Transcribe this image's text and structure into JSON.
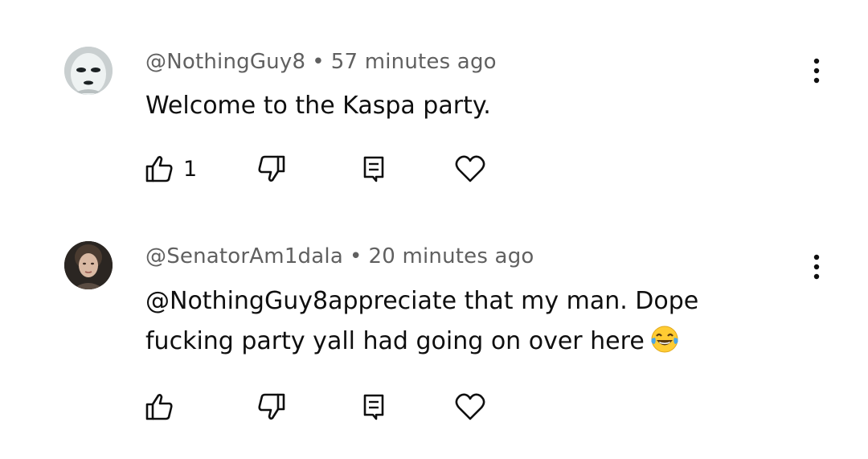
{
  "comments": [
    {
      "author": "@NothingGuy8",
      "separator": "•",
      "time": "57 minutes ago",
      "text": "Welcome to the Kaspa party.",
      "likes": "1",
      "avatar_icon": "white-mask-avatar",
      "menu_icon": "more-vert-icon"
    },
    {
      "author": "@SenatorAm1dala",
      "separator": "•",
      "time": "20 minutes ago",
      "text_line1": "@NothingGuy8appreciate that my man. Dope",
      "text_line2": "fucking party yall had going on over here",
      "emoji": "tears-of-joy-emoji",
      "likes": "",
      "avatar_icon": "portrait-avatar",
      "menu_icon": "more-vert-icon"
    }
  ],
  "action_icons": [
    "like-icon",
    "dislike-icon",
    "reply-icon",
    "heart-icon"
  ],
  "colors": {
    "text": "#0f0f0f",
    "meta": "#606060",
    "background": "#ffffff"
  }
}
